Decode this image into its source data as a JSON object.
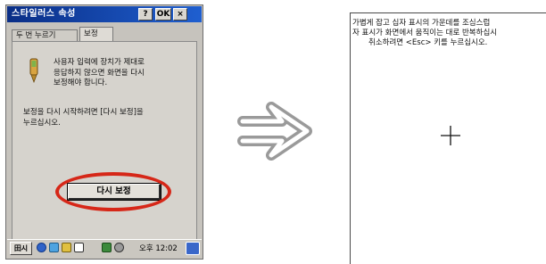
{
  "dialog": {
    "title": "스타일러스 속성",
    "help_label": "?",
    "ok_label": "OK",
    "close_label": "×",
    "tabs": [
      {
        "label": "두 번 누르기",
        "selected": false
      },
      {
        "label": "보정",
        "selected": true
      }
    ],
    "body_text": "사용자 입력에 장치가 제대로\n응답하지 않으면 화면을 다시\n보정해야 합니다.",
    "instruction_text": "보정을 다시 시작하려면 [다시 보정]을\n누르십시오.",
    "recalibrate_label": "다시 보정",
    "highlight_color": "#d62718"
  },
  "taskbar": {
    "start_label": "田시",
    "clock": "오후 12:02",
    "icons": [
      "network-icon",
      "pen-icon",
      "app-icon",
      "connection-icon",
      "settings-icon",
      "keyboard-icon"
    ]
  },
  "calibration_screen": {
    "line1": "가볍게 잡고 십자 표시의 가운데를 조심스럽",
    "line2": "자 표시가 화면에서 움직이는 대로 반복하십시",
    "line3": "취소하려면 <Esc> 키를 누르십시오.",
    "target_icon": "crosshair-icon"
  },
  "arrow_icon": "right-arrow-icon"
}
